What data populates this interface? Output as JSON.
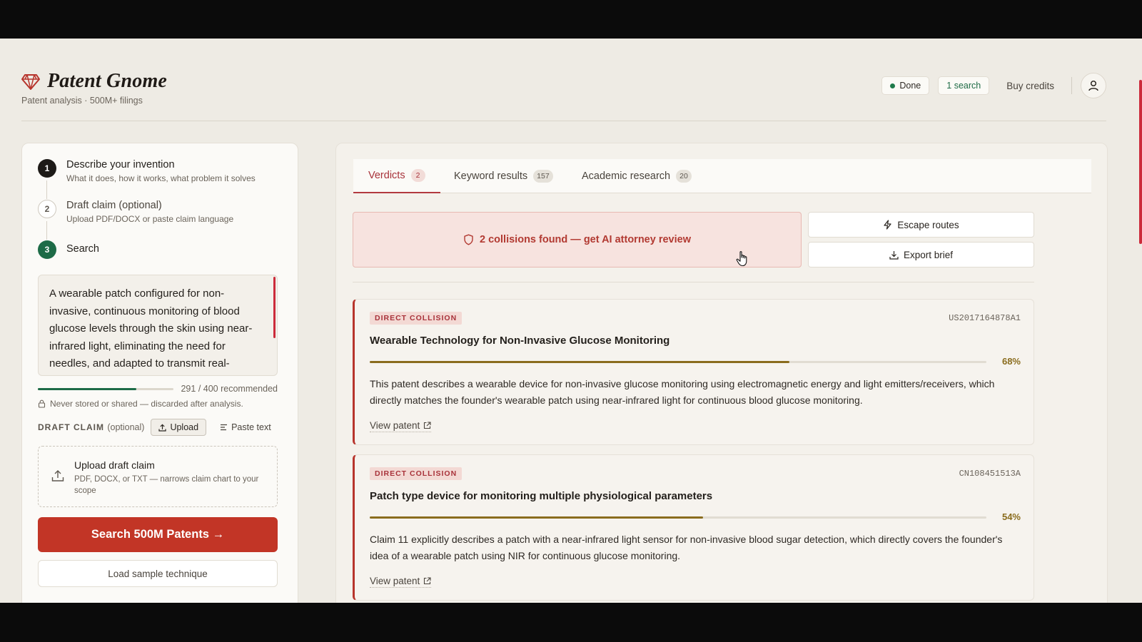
{
  "app": {
    "brand_name": "Patent Gnome",
    "brand_sub": "Patent analysis · 500M+ filings"
  },
  "header": {
    "status_label": "Done",
    "searches_label": "1 search",
    "buy_credits_label": "Buy credits"
  },
  "steps": [
    {
      "number": "1",
      "title": "Describe your invention",
      "desc": "What it does, how it works, what problem it solves"
    },
    {
      "number": "2",
      "title": "Draft claim (optional)",
      "desc": "Upload PDF/DOCX or paste claim language"
    },
    {
      "number": "3",
      "title": "Search",
      "desc": ""
    }
  ],
  "invention": {
    "text": "A wearable patch configured for non-invasive, continuous monitoring of blood glucose levels through the skin using near-infrared light, eliminating the need for needles, and adapted to transmit real-",
    "char_count_label": "291 / 400 recommended",
    "char_progress": 0.7275,
    "privacy_note": "Never stored or shared — discarded after analysis."
  },
  "draft_claim": {
    "label": "DRAFT CLAIM",
    "optional_label": "(optional)",
    "upload_tab": "Upload",
    "paste_tab": "Paste text",
    "dropzone_title": "Upload draft claim",
    "dropzone_desc": "PDF, DOCX, or TXT — narrows claim chart to your scope"
  },
  "actions": {
    "search_button": "Search 500M Patents →",
    "sample_button": "Load sample technique"
  },
  "tabs": [
    {
      "label": "Verdicts",
      "count": "2",
      "active": true
    },
    {
      "label": "Keyword results",
      "count": "157",
      "active": false
    },
    {
      "label": "Academic research",
      "count": "20",
      "active": false
    }
  ],
  "verdicts": {
    "banner_text": "2 collisions found — get AI attorney review",
    "escape_routes_label": "Escape routes",
    "export_brief_label": "Export brief",
    "results": [
      {
        "badge": "DIRECT COLLISION",
        "patent_id": "US2017164878A1",
        "title": "Wearable Technology for Non-Invasive Glucose Monitoring",
        "score": 68,
        "score_label": "68%",
        "description": "This patent describes a wearable device for non-invasive glucose monitoring using electromagnetic energy and light emitters/receivers, which directly matches the founder's wearable patch using near-infrared light for continuous blood glucose monitoring.",
        "link_label": "View patent"
      },
      {
        "badge": "DIRECT COLLISION",
        "patent_id": "CN108451513A",
        "title": "Patch type device for monitoring multiple physiological parameters",
        "score": 54,
        "score_label": "54%",
        "description": "Claim 11 explicitly describes a patch with a near-infrared light sensor for non-invasive blood sugar detection, which directly covers the founder's idea of a wearable patch using NIR for continuous glucose monitoring.",
        "link_label": "View patent"
      }
    ]
  },
  "colors": {
    "accent_red": "#c23526",
    "success_green": "#1d6b47",
    "score_gold": "#8a6c1d",
    "background": "#eeebe4"
  },
  "icons": {
    "logo": "diamond-gem-icon",
    "status": "green-dot-icon",
    "avatar": "user-icon",
    "privacy": "lock-icon",
    "upload": "upload-icon",
    "paste": "text-lines-icon",
    "banner": "shield-icon",
    "escape": "lightning-icon",
    "export": "download-icon",
    "link": "external-link-icon"
  }
}
